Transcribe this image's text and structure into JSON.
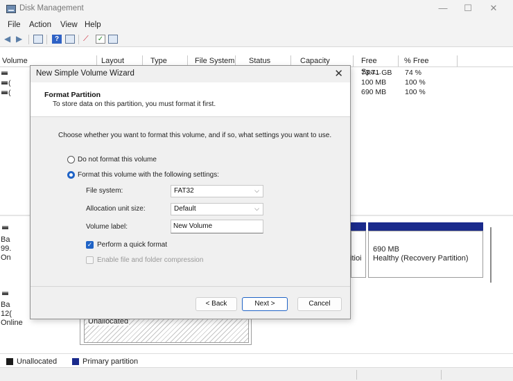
{
  "window": {
    "title": "Disk Management",
    "min": "—",
    "max": "☐",
    "close": "✕"
  },
  "menu": [
    "File",
    "Action",
    "View",
    "Help"
  ],
  "list": {
    "headers": [
      "Volume",
      "Layout",
      "Type",
      "File System",
      "Status",
      "Capacity",
      "Free Spa...",
      "% Free"
    ],
    "rows": [
      {
        "vol": "",
        "free": "73.71 GB",
        "pct": "74 %"
      },
      {
        "vol": "(",
        "free": "100 MB",
        "pct": "100 %"
      },
      {
        "vol": "(",
        "free": "690 MB",
        "pct": "100 %"
      }
    ]
  },
  "disks": {
    "disk0": {
      "l1": "Ba",
      "l2": "99.",
      "l3": "On"
    },
    "disk1": {
      "l1": "Ba",
      "l2": "12(",
      "l3": "Online"
    },
    "partial_label": "itioi",
    "recovery": {
      "size": "690 MB",
      "status": "Healthy (Recovery Partition)"
    },
    "unallocated_label": "Unallocated"
  },
  "legend": {
    "unallocated": "Unallocated",
    "primary": "Primary partition"
  },
  "colors": {
    "unallocated": "#1c1c1c",
    "primary": "#1a2a8c",
    "accent": "#1f63c6"
  },
  "wizard": {
    "title": "New Simple Volume Wizard",
    "close": "✕",
    "heading": "Format Partition",
    "subheading": "To store data on this partition, you must format it first.",
    "prompt": "Choose whether you want to format this volume, and if so, what settings you want to use.",
    "opt_noformat": "Do not format this volume",
    "opt_format": "Format this volume with the following settings:",
    "fs_label": "File system:",
    "fs_value": "FAT32",
    "alloc_label": "Allocation unit size:",
    "alloc_value": "Default",
    "vol_label": "Volume label:",
    "vol_value": "New Volume",
    "quick_format": "Perform a quick format",
    "compression": "Enable file and folder compression",
    "back": "< Back",
    "next": "Next >",
    "cancel": "Cancel"
  }
}
